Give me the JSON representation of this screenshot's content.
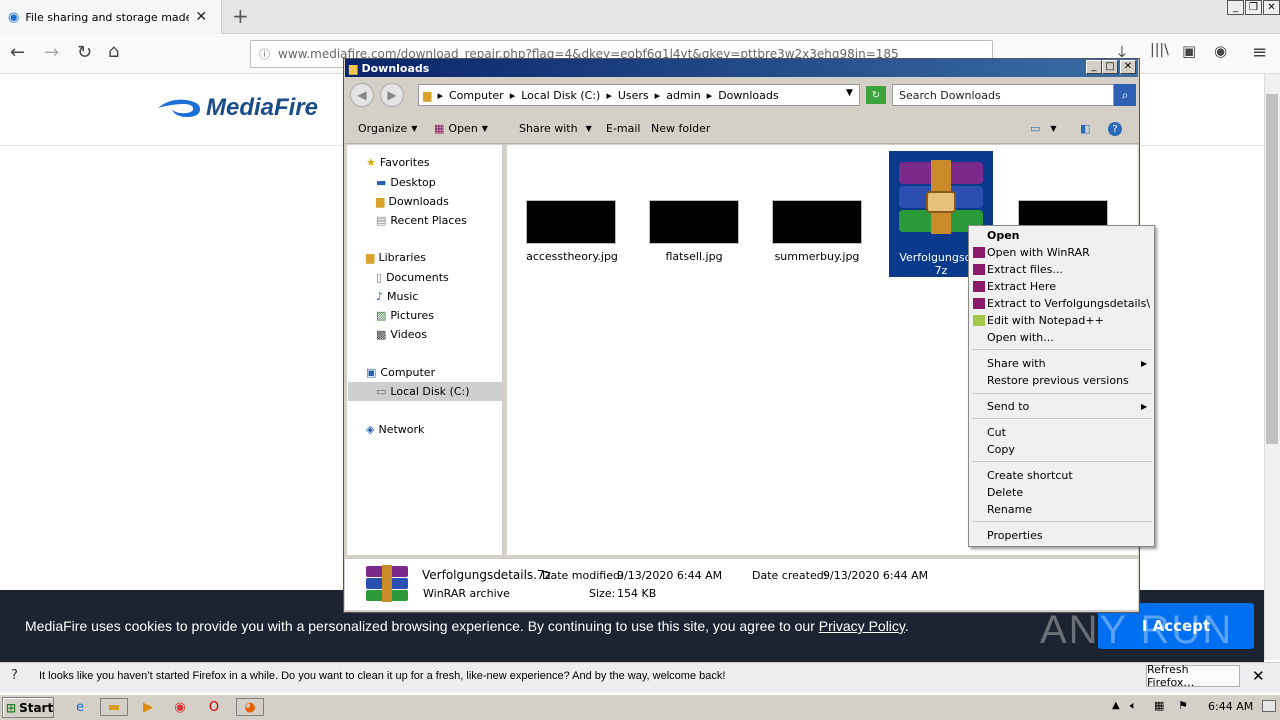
{
  "browser": {
    "tab_title": "File sharing and storage made simp",
    "url": "www.mediafire.com/download_repair.php?flag=4&dkey=eobf6q1l4yt&qkey=pttbre3w2x3ehg98in=185",
    "window_controls": [
      "_",
      "❐",
      "✕"
    ]
  },
  "mediafire": {
    "logo_text": "MediaFire",
    "cookie_text": "MediaFire uses cookies to provide you with a personalized browsing experience. By continuing to use this site, you agree to our",
    "cookie_link": "Privacy Policy",
    "cookie_end": ".",
    "accept_label": "I Accept",
    "watermark": "ANY RUN"
  },
  "notification": {
    "text": "It looks like you haven’t started Firefox in a while. Do you want to clean it up for a fresh, like-new experience? And by the way, welcome back!",
    "button": "Refresh Firefox…"
  },
  "taskbar": {
    "start": "Start",
    "clock": "6:44 AM"
  },
  "explorer": {
    "title": "Downloads",
    "breadcrumb": [
      "Computer",
      "Local Disk (C:)",
      "Users",
      "admin",
      "Downloads"
    ],
    "search_placeholder": "Search Downloads",
    "toolbar": [
      "Organize",
      "Open",
      "Share with",
      "E-mail",
      "New folder"
    ],
    "nav": {
      "favorites": "Favorites",
      "desktop": "Desktop",
      "downloads": "Downloads",
      "recent": "Recent Places",
      "libraries": "Libraries",
      "documents": "Documents",
      "music": "Music",
      "pictures": "Pictures",
      "videos": "Videos",
      "computer": "Computer",
      "local_disk": "Local Disk (C:)",
      "network": "Network"
    },
    "files": [
      "accesstheory.jpg",
      "flatsell.jpg",
      "summerbuy.jpg"
    ],
    "selected_file": "Verfolgungsdetails.7z",
    "selected_file_label_line1": "Verfolgungsdet",
    "selected_file_label_line2": "7z",
    "details": {
      "name": "Verfolgungsdetails.7z",
      "type": "WinRAR archive",
      "modified_label": "Date modified:",
      "modified": "9/13/2020 6:44 AM",
      "created_label": "Date created:",
      "created": "9/13/2020 6:44 AM",
      "size_label": "Size:",
      "size": "154 KB"
    }
  },
  "context_menu": {
    "open": "Open",
    "open_winrar": "Open with WinRAR",
    "extract_files": "Extract files...",
    "extract_here": "Extract Here",
    "extract_to": "Extract to Verfolgungsdetails\\",
    "edit_notepad": "Edit with Notepad++",
    "open_with": "Open with...",
    "share_with": "Share with",
    "restore": "Restore previous versions",
    "send_to": "Send to",
    "cut": "Cut",
    "copy": "Copy",
    "create_shortcut": "Create shortcut",
    "delete": "Delete",
    "rename": "Rename",
    "properties": "Properties"
  }
}
